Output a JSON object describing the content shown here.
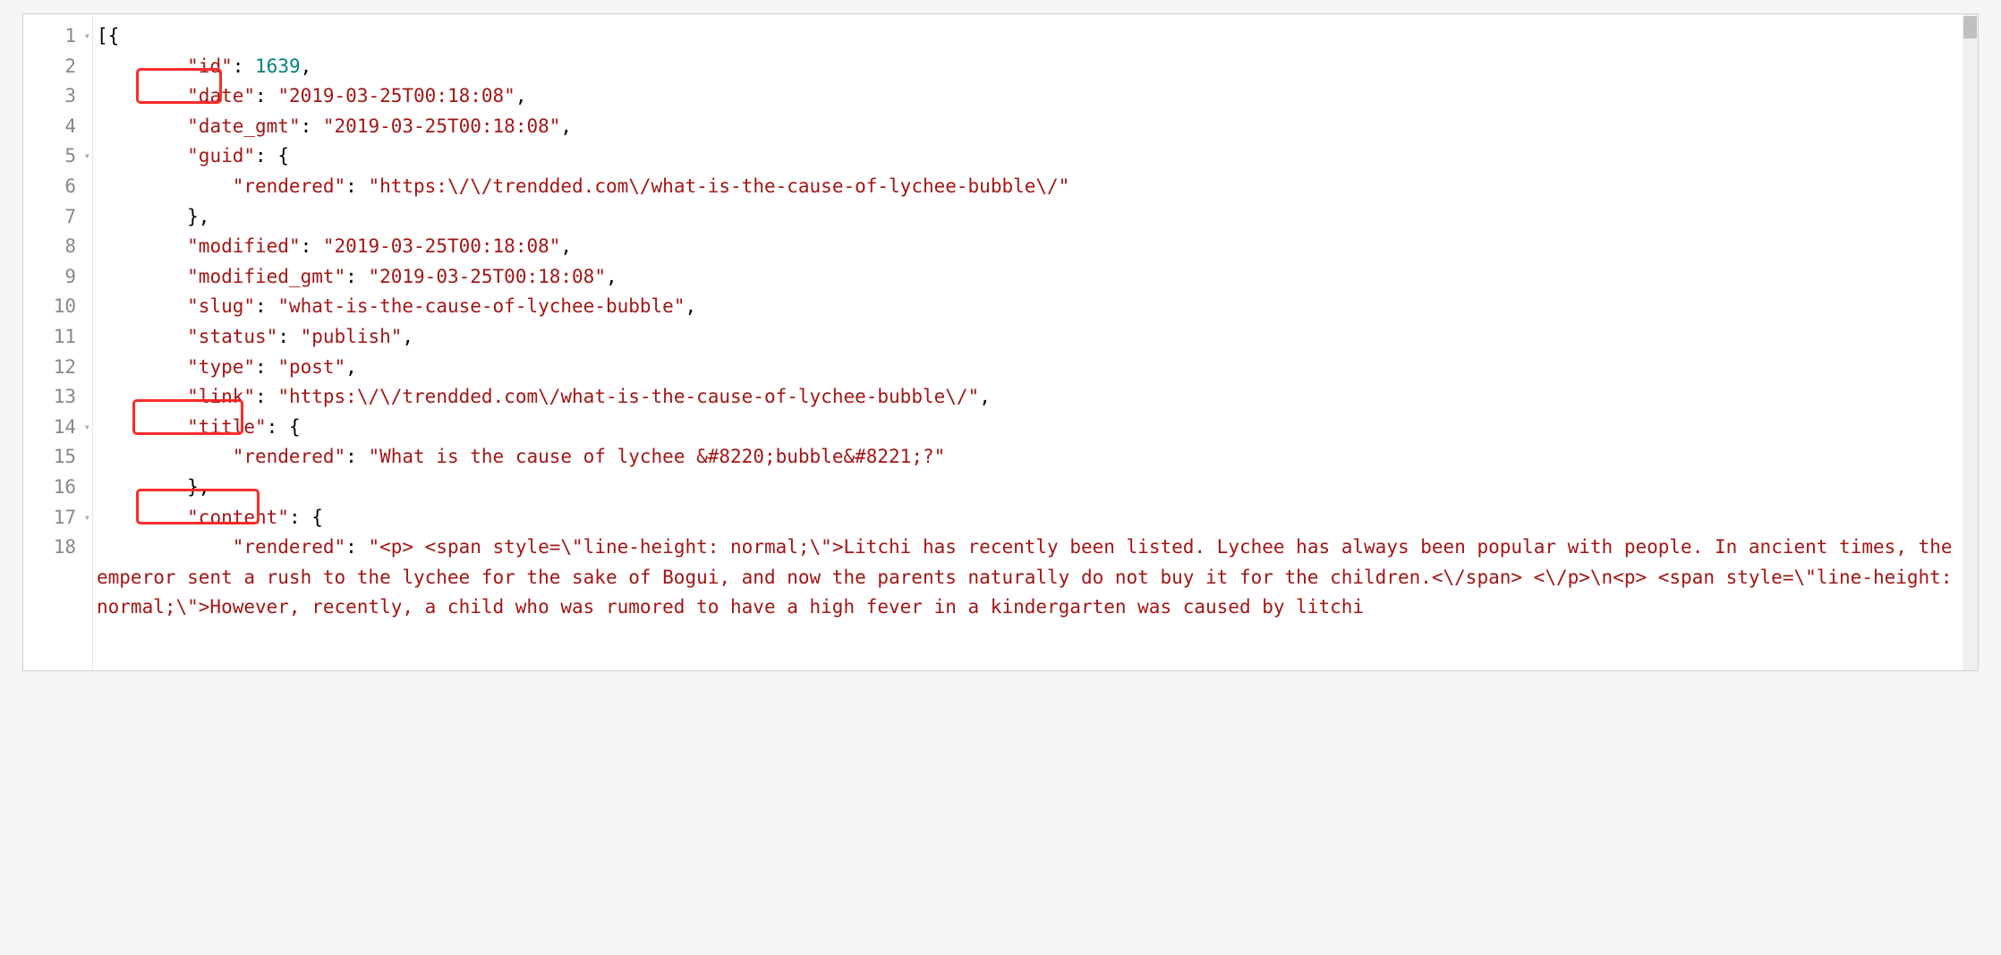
{
  "colors": {
    "string": "#A31515",
    "number": "#008080",
    "punct": "#000000",
    "gutter_text": "#888888",
    "highlight_box": "#ff2a2a"
  },
  "line_numbers": [
    "1",
    "2",
    "3",
    "4",
    "5",
    "6",
    "7",
    "8",
    "9",
    "10",
    "11",
    "12",
    "13",
    "14",
    "15",
    "16",
    "17",
    "18"
  ],
  "fold_lines": [
    1,
    5,
    14,
    17
  ],
  "highlights": [
    {
      "key": "date",
      "line": 3
    },
    {
      "key": "title",
      "line": 14
    },
    {
      "key": "content",
      "line": 17
    }
  ],
  "json_content": {
    "id": 1639,
    "date": "2019-03-25T00:18:08",
    "date_gmt": "2019-03-25T00:18:08",
    "guid": {
      "rendered": "https:\\/\\/trendded.com\\/what-is-the-cause-of-lychee-bubble\\/"
    },
    "modified": "2019-03-25T00:18:08",
    "modified_gmt": "2019-03-25T00:18:08",
    "slug": "what-is-the-cause-of-lychee-bubble",
    "status": "publish",
    "type": "post",
    "link": "https:\\/\\/trendded.com\\/what-is-the-cause-of-lychee-bubble\\/",
    "title": {
      "rendered": "What is the cause of lychee &#8220;bubble&#8221;?"
    },
    "content_rendered": "<p> <span style=\\\"line-height: normal;\\\">Litchi has recently been listed. Lychee has always been popular with people. In ancient times, the emperor sent a rush to the lychee for the sake of Bogui, and now the parents naturally do not buy it for the children.<\\/span> <\\/p>\\n<p> <span style=\\\"line-height: normal;\\\">However, recently, a child who was rumored to have a high fever in a kindergarten was caused by litchi"
  },
  "tokens": {
    "l1": {
      "b": "[{"
    },
    "l2": {
      "k": "\"id\"",
      "c": ": ",
      "v": "1639",
      "p": ","
    },
    "l3": {
      "k": "\"date\"",
      "c": ": ",
      "v": "\"2019-03-25T00:18:08\"",
      "p": ","
    },
    "l4": {
      "k": "\"date_gmt\"",
      "c": ": ",
      "v": "\"2019-03-25T00:18:08\"",
      "p": ","
    },
    "l5": {
      "k": "\"guid\"",
      "c": ": ",
      "b": "{"
    },
    "l6": {
      "k": "\"rendered\"",
      "c": ": ",
      "v": "\"https:\\/\\/trendded.com\\/what-is-the-cause-of-lychee-bubble\\/\""
    },
    "l7": {
      "b": "},"
    },
    "l8": {
      "k": "\"modified\"",
      "c": ": ",
      "v": "\"2019-03-25T00:18:08\"",
      "p": ","
    },
    "l9": {
      "k": "\"modified_gmt\"",
      "c": ": ",
      "v": "\"2019-03-25T00:18:08\"",
      "p": ","
    },
    "l10": {
      "k": "\"slug\"",
      "c": ": ",
      "v": "\"what-is-the-cause-of-lychee-bubble\"",
      "p": ","
    },
    "l11": {
      "k": "\"status\"",
      "c": ": ",
      "v": "\"publish\"",
      "p": ","
    },
    "l12": {
      "k": "\"type\"",
      "c": ": ",
      "v": "\"post\"",
      "p": ","
    },
    "l13": {
      "k": "\"link\"",
      "c": ": ",
      "v": "\"https:\\/\\/trendded.com\\/what-is-the-cause-of-lychee-bubble\\/\"",
      "p": ","
    },
    "l14": {
      "k": "\"title\"",
      "c": ": ",
      "b": "{"
    },
    "l15": {
      "k": "\"rendered\"",
      "c": ": ",
      "v": "\"What is the cause of lychee &#8220;bubble&#8221;?\""
    },
    "l16": {
      "b": "},"
    },
    "l17": {
      "k": "\"content\"",
      "c": ": ",
      "b": "{"
    },
    "l18": {
      "k": "\"rendered\"",
      "c": ": ",
      "v": "\"<p> <span style=\\\"line-height: normal;\\\">Litchi has recently been listed. Lychee has always been popular with people. In ancient times, the emperor sent a rush to the lychee for the sake of Bogui, and now the parents naturally do not buy it for the children.<\\/span> <\\/p>\\n<p> <span style=\\\"line-height: normal;\\\">However, recently, a child who was rumored to have a high fever in a kindergarten was caused by litchi"
    }
  }
}
